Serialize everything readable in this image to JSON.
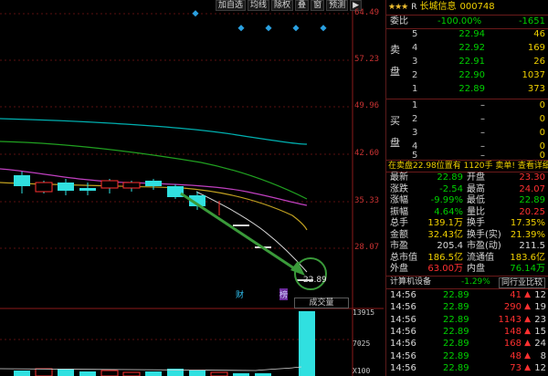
{
  "toolbar": {
    "items": [
      "加自选",
      "均线",
      "除权",
      "叠",
      "窗",
      "预测"
    ],
    "menu_arrow": "▶"
  },
  "chart": {
    "price_ticks": [
      "64.49",
      "57.23",
      "49.96",
      "42.60",
      "35.33",
      "28.07"
    ],
    "current_price_label": "22.89",
    "markers": {
      "finance": "财",
      "news": "榜"
    },
    "volume_label": "成交量",
    "volume_ticks": [
      "13915",
      "7025",
      "X100"
    ]
  },
  "quote_header": {
    "stars": "★★★",
    "flag": "R",
    "name": "长城信息",
    "code": "000748"
  },
  "weibi": {
    "label": "委比",
    "pct": "-100.00%",
    "diff": "-1651"
  },
  "sell_label": [
    "卖",
    "盘"
  ],
  "buy_label": [
    "买",
    "盘"
  ],
  "sell_book": [
    {
      "level": "5",
      "price": "22.94",
      "vol": "46"
    },
    {
      "level": "4",
      "price": "22.92",
      "vol": "169"
    },
    {
      "level": "3",
      "price": "22.91",
      "vol": "26"
    },
    {
      "level": "2",
      "price": "22.90",
      "vol": "1037"
    },
    {
      "level": "1",
      "price": "22.89",
      "vol": "373"
    }
  ],
  "buy_book": [
    {
      "level": "1",
      "price": "–",
      "vol": "0"
    },
    {
      "level": "2",
      "price": "–",
      "vol": "0"
    },
    {
      "level": "3",
      "price": "–",
      "vol": "0"
    },
    {
      "level": "4",
      "price": "–",
      "vol": "0"
    },
    {
      "level": "5",
      "price": "–",
      "vol": "0"
    }
  ],
  "notice": {
    "text": "在卖盘22.98位置有 1120手 卖单! 查看详细"
  },
  "quotes": [
    {
      "l1": "最新",
      "v1": "22.89",
      "l2": "开盘",
      "v2": "23.30"
    },
    {
      "l1": "涨跌",
      "v1": "-2.54",
      "l2": "最高",
      "v2": "24.07"
    },
    {
      "l1": "涨幅",
      "v1": "-9.99%",
      "l2": "最低",
      "v2": "22.89"
    },
    {
      "l1": "振幅",
      "v1": "4.64%",
      "l2": "量比",
      "v2": "20.25"
    },
    {
      "l1": "总手",
      "v1": "139.1万",
      "l2": "换手",
      "v2": "17.35%"
    },
    {
      "l1": "金额",
      "v1": "32.43亿",
      "l2": "换手(实)",
      "v2": "21.39%"
    },
    {
      "l1": "市盈",
      "v1": "205.4",
      "l2": "市盈(动)",
      "v2": "211.5"
    },
    {
      "l1": "总市值",
      "v1": "186.5亿",
      "l2": "流通值",
      "v2": "183.6亿"
    },
    {
      "l1": "外盘",
      "v1": "63.00万",
      "l2": "内盘",
      "v2": "76.14万"
    }
  ],
  "industry": {
    "name": "计算机设备",
    "pct": "-1.29%",
    "compare": "同行业比较"
  },
  "ticks": [
    {
      "time": "14:56",
      "price": "22.89",
      "vol": "41",
      "n": "12"
    },
    {
      "time": "14:56",
      "price": "22.89",
      "vol": "290",
      "n": "19"
    },
    {
      "time": "14:56",
      "price": "22.89",
      "vol": "1143",
      "n": "23"
    },
    {
      "time": "14:56",
      "price": "22.89",
      "vol": "148",
      "n": "15"
    },
    {
      "time": "14:56",
      "price": "22.89",
      "vol": "168",
      "n": "24"
    },
    {
      "time": "14:56",
      "price": "22.89",
      "vol": "48",
      "n": "8"
    },
    {
      "time": "14:56",
      "price": "22.89",
      "vol": "73",
      "n": "12"
    }
  ],
  "colors": {
    "up": "#ff3030",
    "down": "#00d000",
    "accent": "#f0d000",
    "grid": "#8b1a1a"
  }
}
